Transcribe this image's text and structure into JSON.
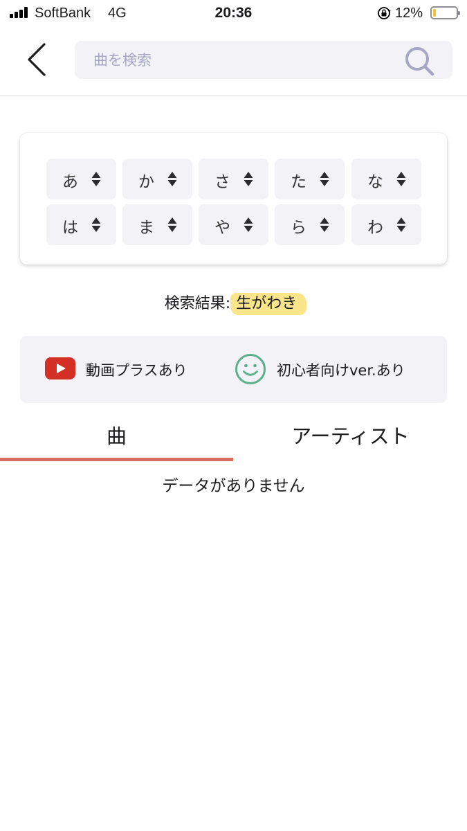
{
  "status_bar": {
    "carrier": "SoftBank",
    "network": "4G",
    "time": "20:36",
    "battery_percent": "12%",
    "battery_level": 0.12,
    "battery_color": "#f4c430"
  },
  "nav": {
    "back_icon": "chevron-left-icon",
    "search_placeholder": "曲を検索",
    "search_value": "",
    "search_icon": "magnifier-icon"
  },
  "kana_filter": {
    "sort_icon": "sort-updown-icon",
    "rows": [
      [
        "あ",
        "か",
        "さ",
        "た",
        "な"
      ],
      [
        "は",
        "ま",
        "や",
        "ら",
        "わ"
      ]
    ]
  },
  "result": {
    "label": "検索結果:",
    "term": "生がわき",
    "highlight_color": "#fbe58a"
  },
  "features": {
    "video": {
      "icon": "youtube-icon",
      "label": "動画プラスあり",
      "color": "#d32f24"
    },
    "beginner": {
      "icon": "smile-icon",
      "label": "初心者向けver.あり",
      "color": "#5bb08c"
    }
  },
  "tabs": {
    "items": [
      "曲",
      "アーティスト"
    ],
    "active_index": 0,
    "indicator_color": "#d96b5f"
  },
  "empty_message": "データがありません"
}
